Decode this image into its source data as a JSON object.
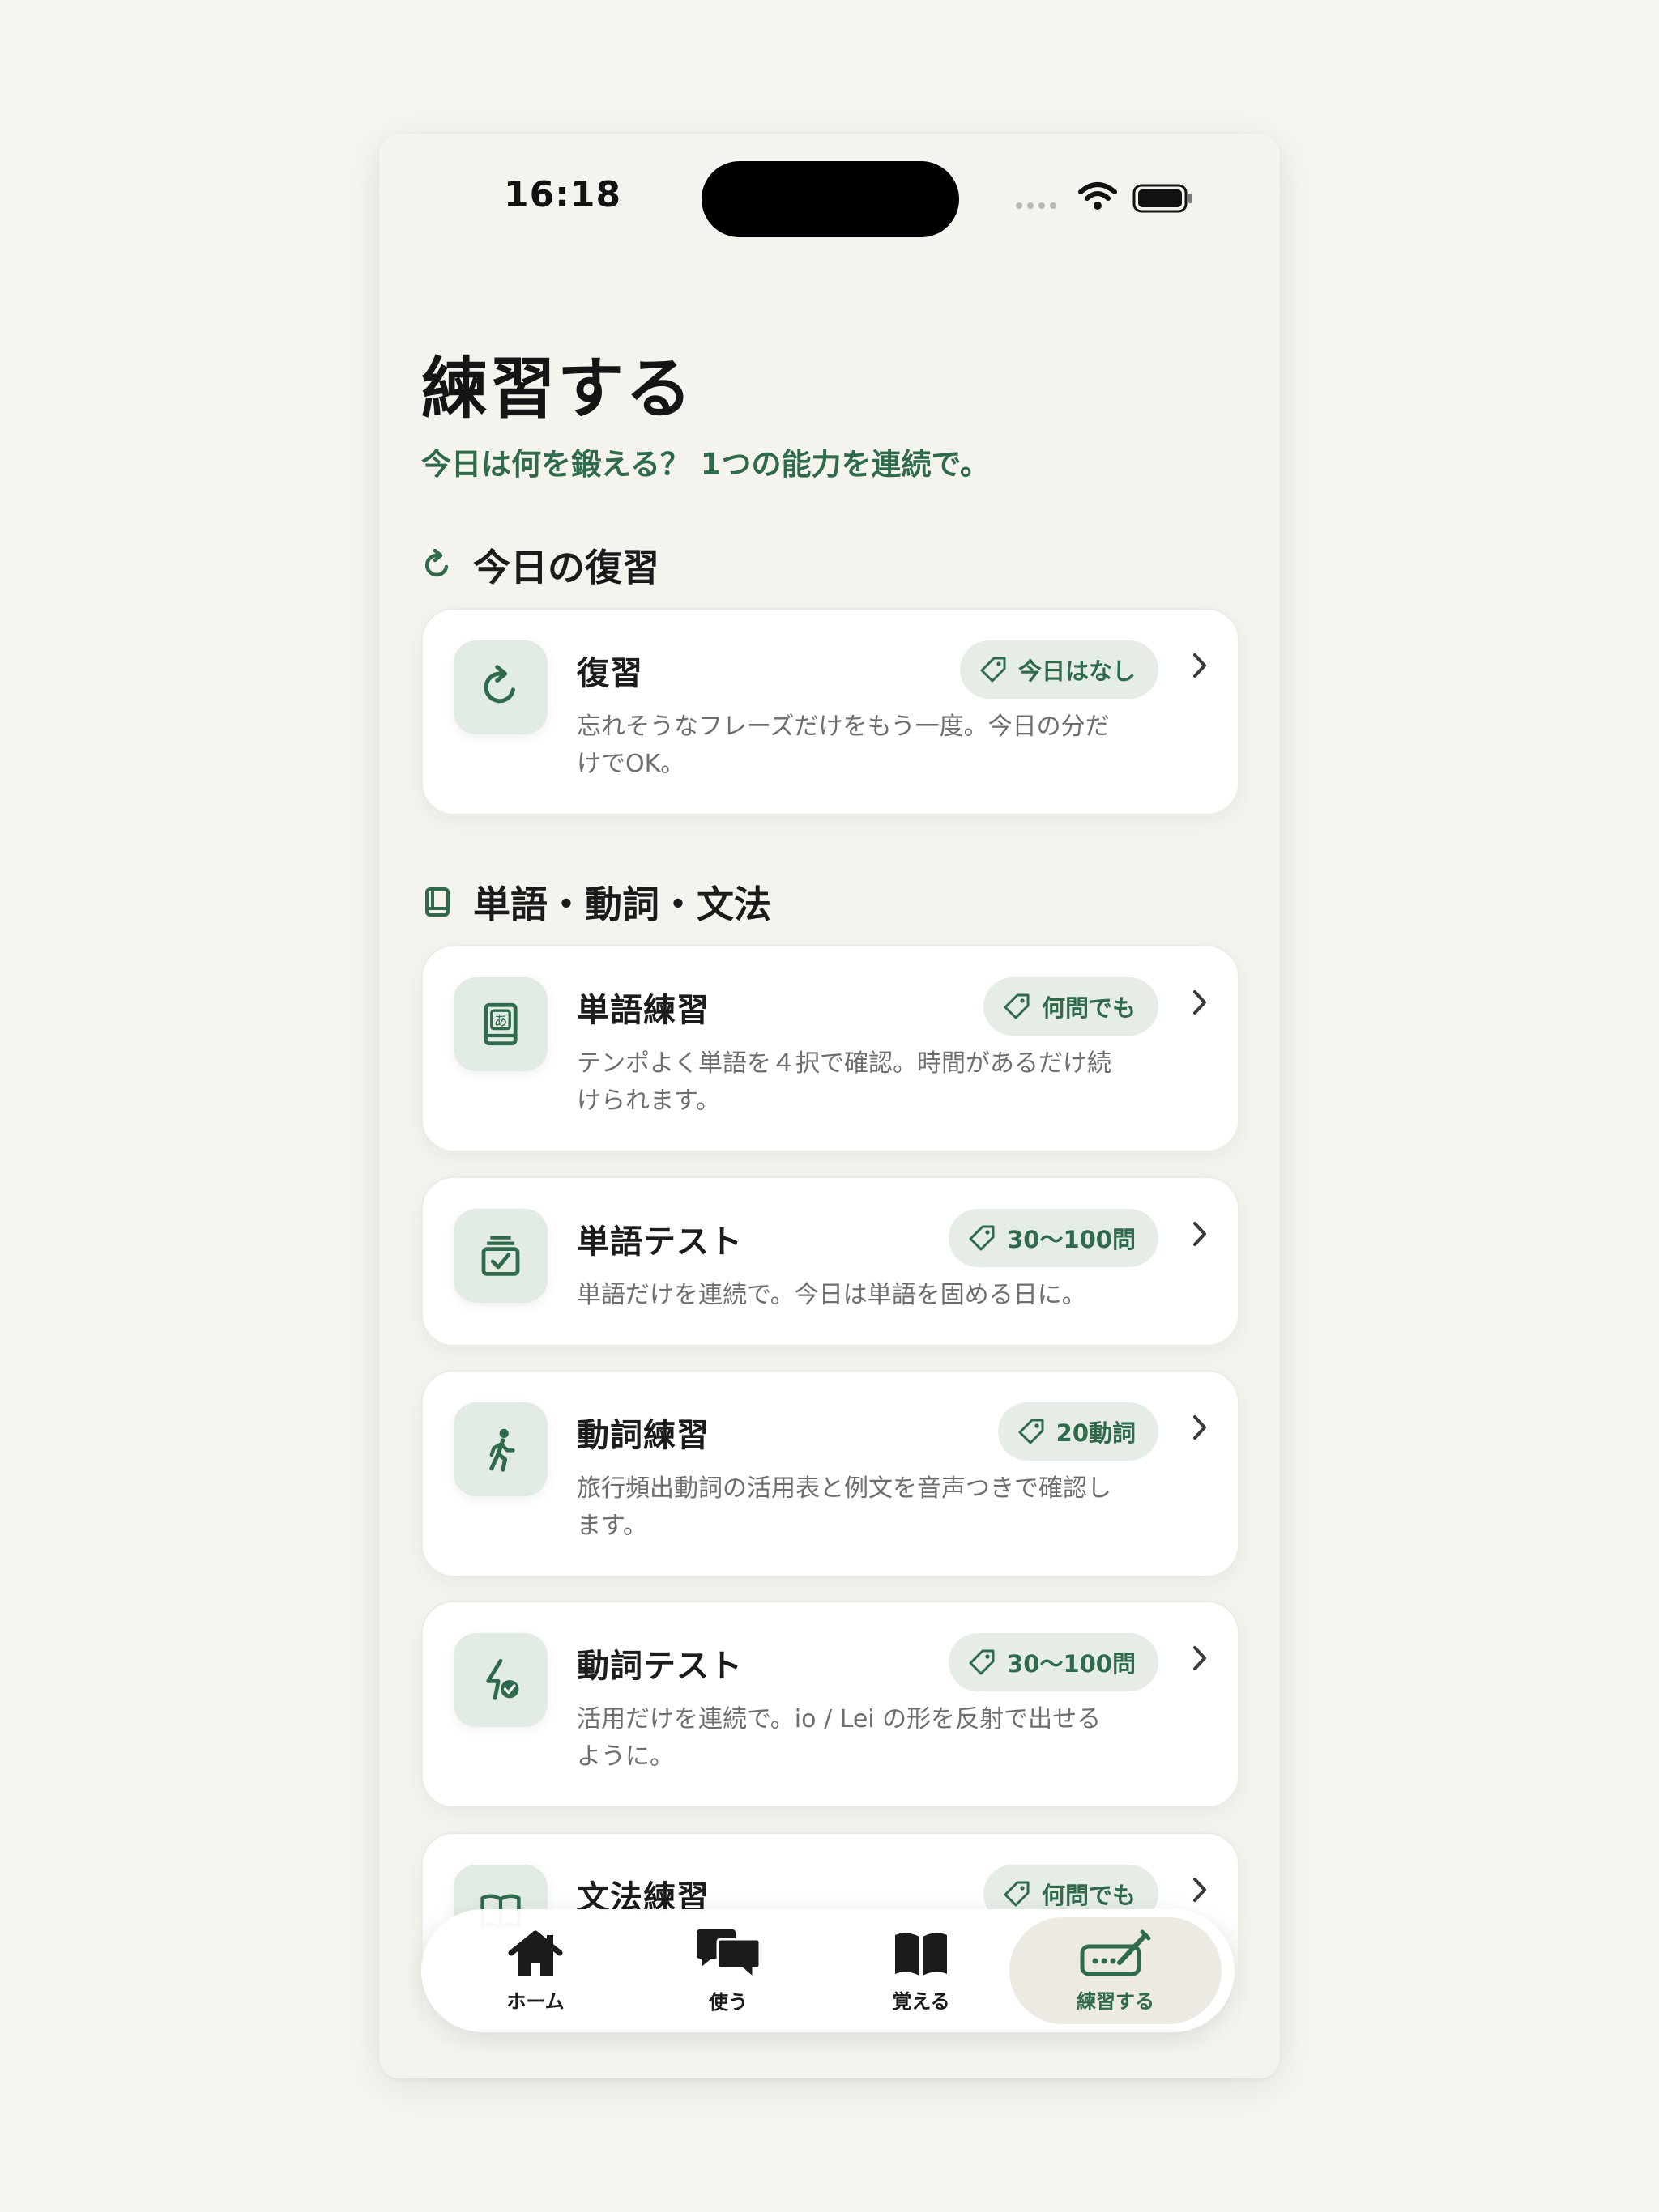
{
  "status_bar": {
    "time": "16:18"
  },
  "header": {
    "title": "練習する",
    "subtitle": "今日は何を鍛える？ 1つの能力を連続で。"
  },
  "sections": [
    {
      "title": "今日の復習",
      "icon": "refresh-icon"
    },
    {
      "title": "単語・動詞・文法",
      "icon": "book-icon"
    }
  ],
  "cards": [
    {
      "title": "復習",
      "badge": "今日はなし",
      "desc": "忘れそうなフレーズだけをもう一度。今日の分だけでOK。",
      "icon": "refresh-icon"
    },
    {
      "title": "単語練習",
      "badge": "何問でも",
      "desc": "テンポよく単語を４択で確認。時間があるだけ続けられます。",
      "icon": "vocab-book-icon"
    },
    {
      "title": "単語テスト",
      "badge": "30〜100問",
      "desc": "単語だけを連続で。今日は単語を固める日に。",
      "icon": "checklist-box-icon"
    },
    {
      "title": "動詞練習",
      "badge": "20動詞",
      "desc": "旅行頻出動詞の活用表と例文を音声つきで確認します。",
      "icon": "walking-person-icon"
    },
    {
      "title": "動詞テスト",
      "badge": "30〜100問",
      "desc": "活用だけを連続で。io / Lei の形を反射で出せるように。",
      "icon": "bolt-check-icon"
    },
    {
      "title": "文法練習",
      "badge": "何問でも",
      "desc": "",
      "icon": "open-book-icon"
    }
  ],
  "tabbar": {
    "items": [
      {
        "label": "ホーム",
        "icon": "house-icon"
      },
      {
        "label": "使う",
        "icon": "chat-bubbles-icon"
      },
      {
        "label": "覚える",
        "icon": "open-book-icon"
      },
      {
        "label": "練習する",
        "icon": "pencil-keyboard-icon",
        "active": true
      }
    ]
  },
  "colors": {
    "accent": "#2f6a4d",
    "icon_bg": "#e3ece4",
    "background": "#f5f3ee"
  }
}
